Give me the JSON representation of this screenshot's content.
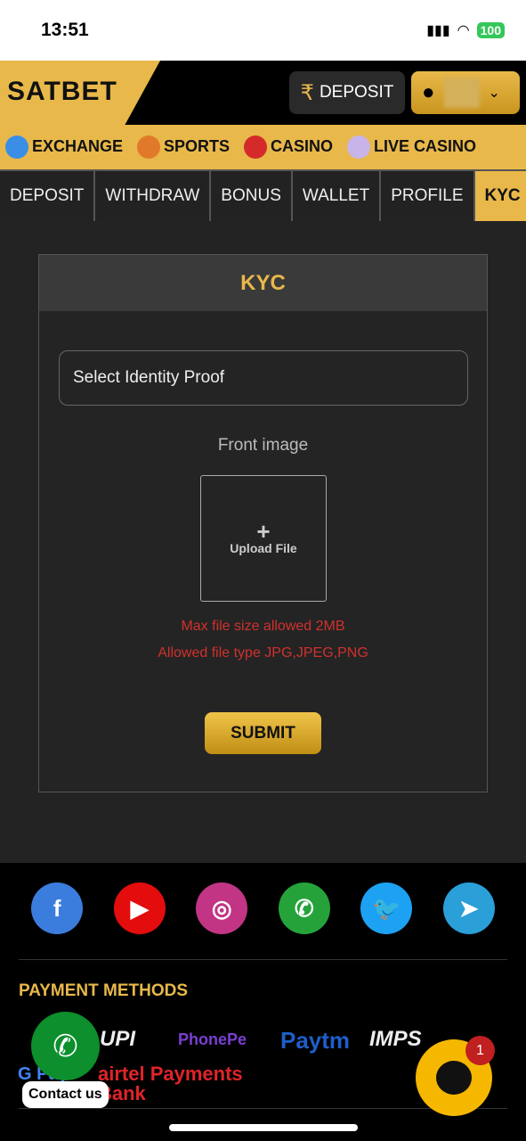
{
  "status": {
    "time": "13:51",
    "battery": "100"
  },
  "header": {
    "logo": "SATBET",
    "deposit_label": "DEPOSIT",
    "currency_symbol": "₹"
  },
  "categories": [
    {
      "label": "EXCHANGE",
      "icon": "exchange-icon",
      "color": "#3a8ee6"
    },
    {
      "label": "SPORTS",
      "icon": "sports-icon",
      "color": "#e07a2a"
    },
    {
      "label": "CASINO",
      "icon": "casino-chip-icon",
      "color": "#d42a2a"
    },
    {
      "label": "LIVE CASINO",
      "icon": "cards-icon",
      "color": "#c8b4e8"
    }
  ],
  "tabs": [
    "DEPOSIT",
    "WITHDRAW",
    "BONUS",
    "WALLET",
    "PROFILE",
    "KYC"
  ],
  "active_tab": "KYC",
  "kyc": {
    "title": "KYC",
    "select_placeholder": "Select Identity Proof",
    "front_label": "Front image",
    "upload_plus": "+",
    "upload_label": "Upload File",
    "max_size": "Max file size allowed 2MB",
    "file_types": "Allowed file type JPG,JPEG,PNG",
    "submit_label": "SUBMIT"
  },
  "footer": {
    "social": [
      {
        "name": "facebook",
        "glyph": "f",
        "color": "#3b7ddd"
      },
      {
        "name": "youtube",
        "glyph": "▶",
        "color": "#e30d0d"
      },
      {
        "name": "instagram",
        "glyph": "◎",
        "color": "#c13584"
      },
      {
        "name": "whatsapp",
        "glyph": "✆",
        "color": "#25a33a"
      },
      {
        "name": "twitter",
        "glyph": "🐦",
        "color": "#1da1f2"
      },
      {
        "name": "telegram",
        "glyph": "➤",
        "color": "#2a9fd8"
      }
    ],
    "payment_title": "PAYMENT METHODS",
    "payments": [
      "UPI",
      "PhonePe",
      "Paytm",
      "IMPS",
      "G Pay",
      "airtel Payments Bank"
    ]
  },
  "contact_label": "Contact us",
  "chat_badge": "1"
}
